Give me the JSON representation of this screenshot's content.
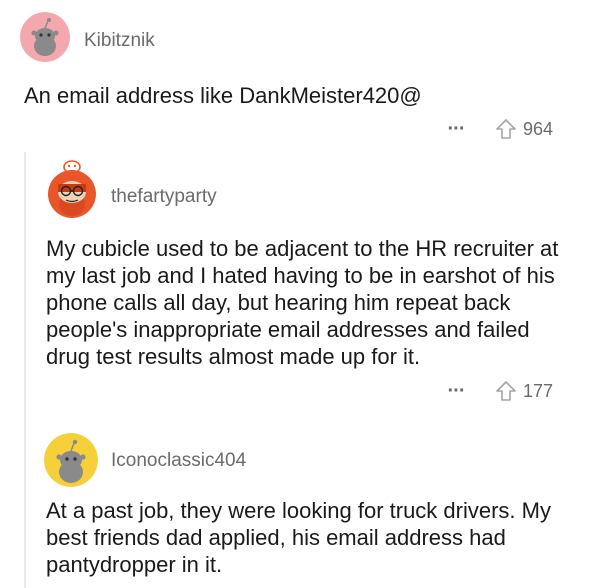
{
  "comments": [
    {
      "username": "Kibitznik",
      "body": "An email address like DankMeister420@",
      "score": "964",
      "more_icon": "more-dots-icon",
      "upvote_icon": "upvote-arrow-icon",
      "avatar_color": "#f4a7ad"
    },
    {
      "username": "thefartyparty",
      "body": "My cubicle used to be adjacent to the HR recruiter at my last job and I hated having to be in earshot of his phone calls all day, but hearing him repeat back people's inappropriate email addresses and failed drug test results almost made up for it.",
      "score": "177",
      "more_icon": "more-dots-icon",
      "upvote_icon": "upvote-arrow-icon",
      "avatar_color": "#e8562a"
    },
    {
      "username": "Iconoclassic404",
      "body": "At a past job, they were looking for truck drivers. My best friends dad applied, his email address had pantydropper in it.",
      "avatar_color": "#f5d03b"
    }
  ]
}
